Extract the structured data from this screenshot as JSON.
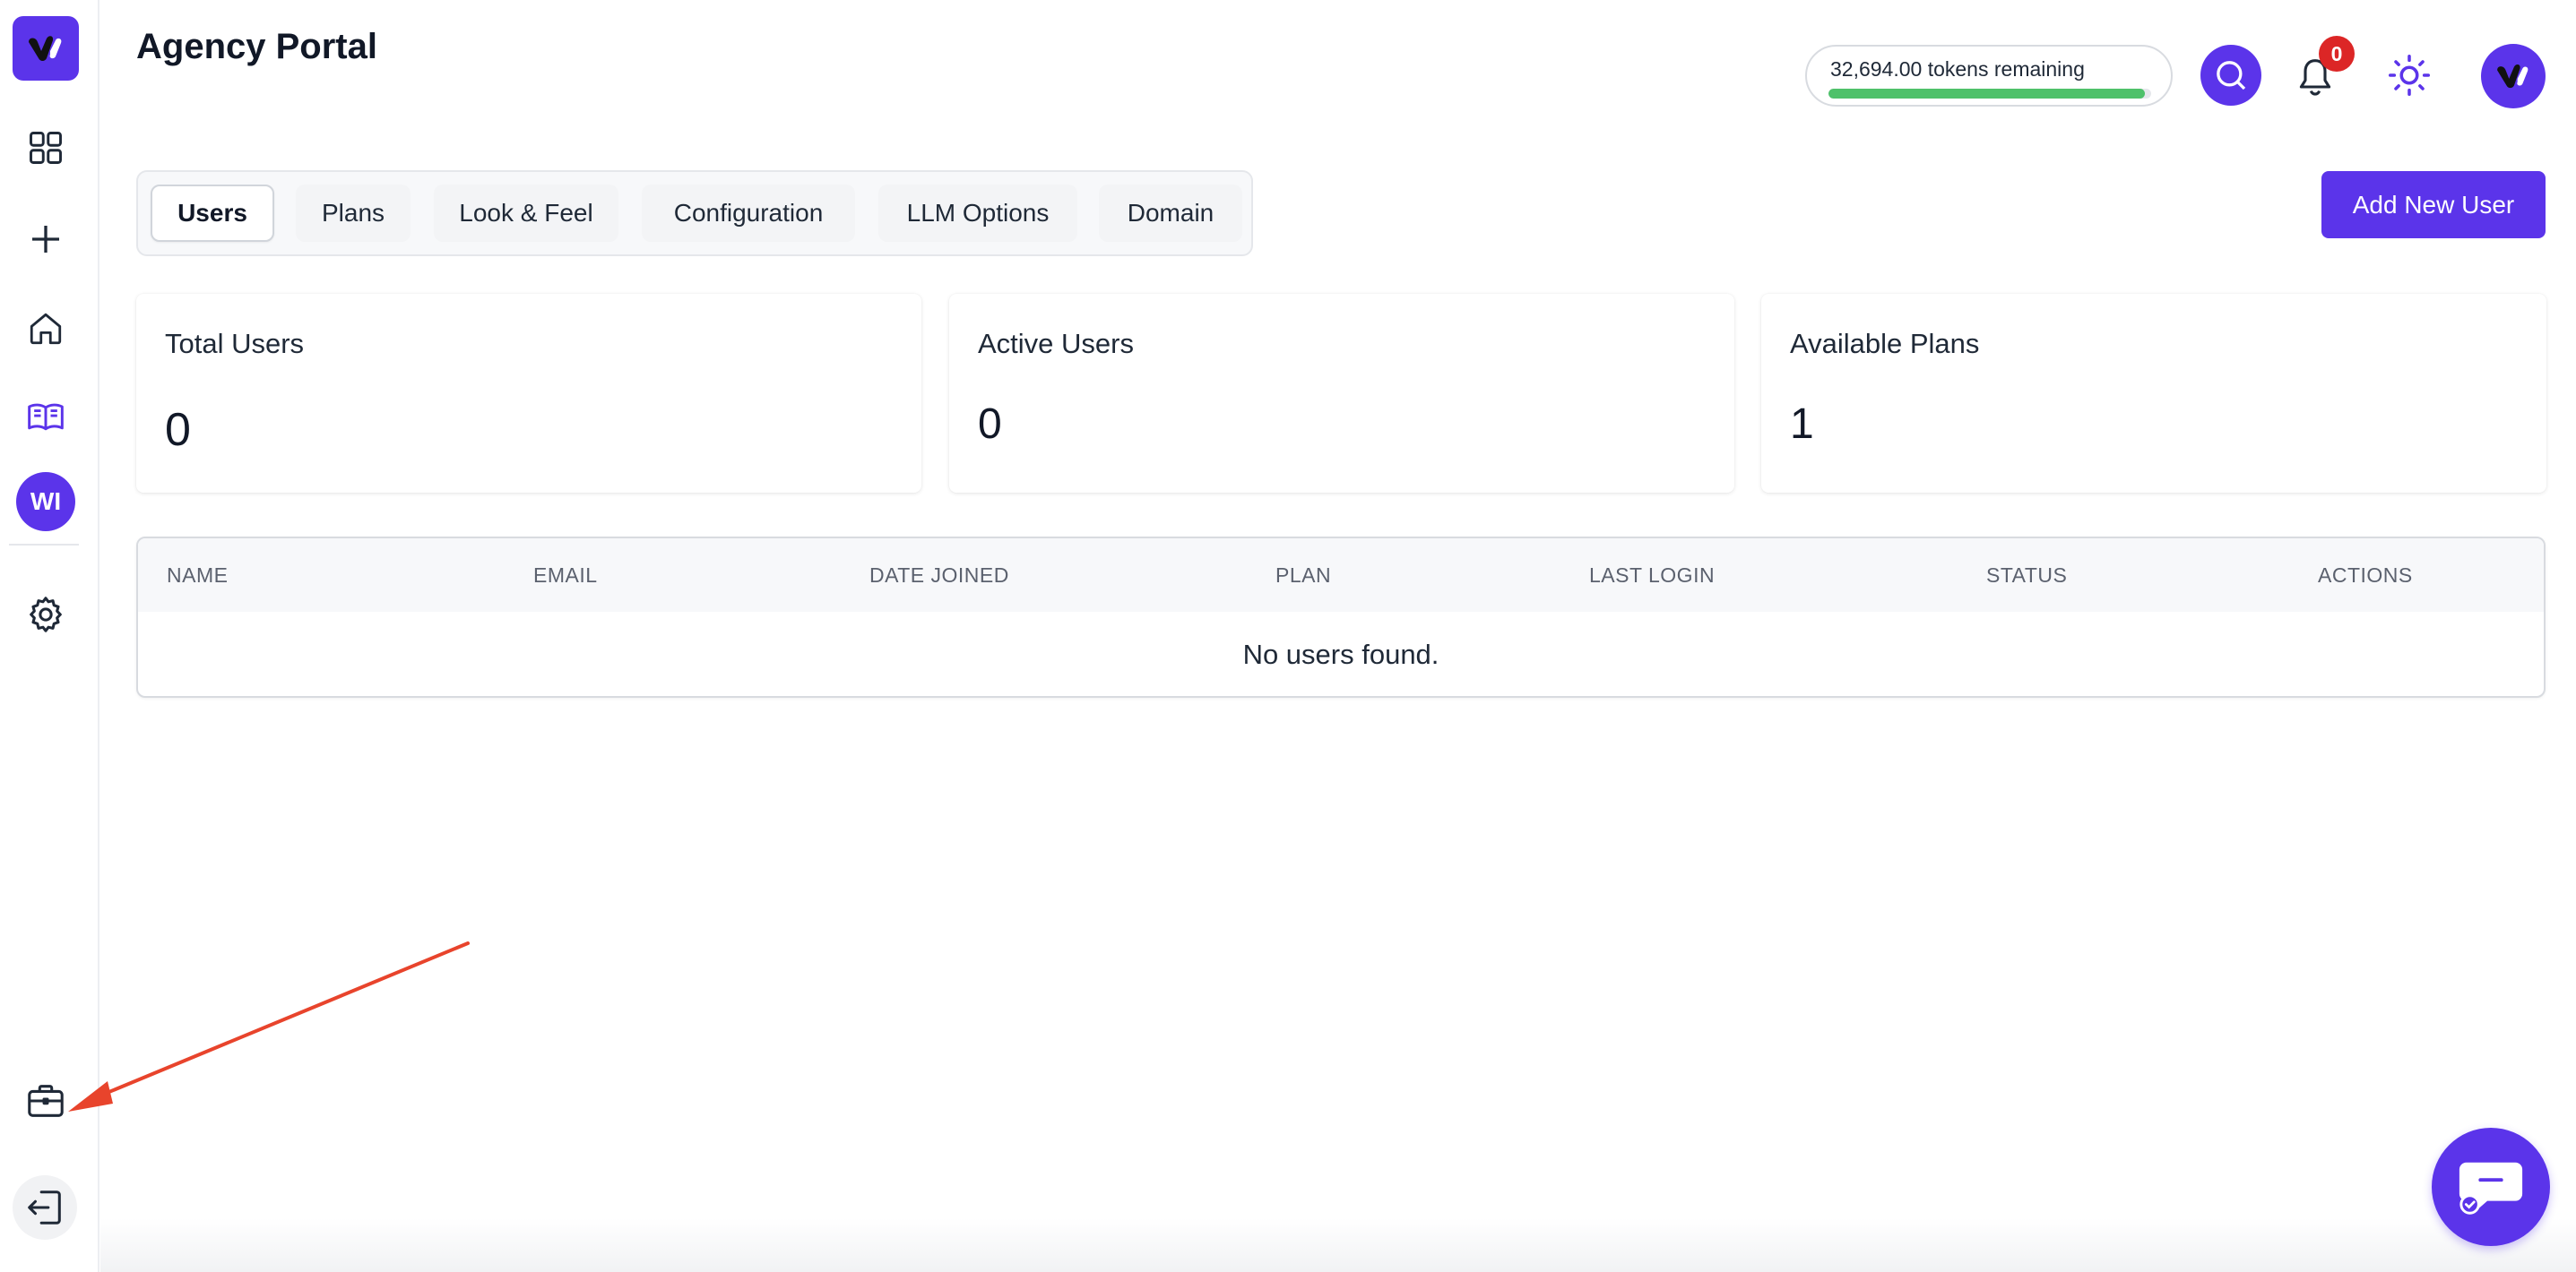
{
  "header": {
    "title": "Agency Portal",
    "tokens_text": "32,694.00 tokens remaining",
    "tokens_fraction": 0.98,
    "notification_count": "0"
  },
  "sidebar": {
    "avatar_initials": "WI",
    "items": [
      {
        "name": "dashboard-grid",
        "icon": "grid-icon"
      },
      {
        "name": "new",
        "icon": "plus-icon"
      },
      {
        "name": "home",
        "icon": "home-icon"
      },
      {
        "name": "library",
        "icon": "book-icon"
      },
      {
        "name": "settings",
        "icon": "gear-icon"
      },
      {
        "name": "agency",
        "icon": "briefcase-icon"
      },
      {
        "name": "logout",
        "icon": "logout-icon"
      }
    ]
  },
  "tabs": [
    {
      "label": "Users",
      "active": true
    },
    {
      "label": "Plans",
      "active": false
    },
    {
      "label": "Look & Feel",
      "active": false
    },
    {
      "label": "Configuration",
      "active": false
    },
    {
      "label": "LLM Options",
      "active": false
    },
    {
      "label": "Domain",
      "active": false
    }
  ],
  "actions": {
    "add_user_label": "Add New User"
  },
  "stats": [
    {
      "label": "Total Users",
      "value": "0"
    },
    {
      "label": "Active Users",
      "value": "0"
    },
    {
      "label": "Available Plans",
      "value": "1"
    }
  ],
  "table": {
    "columns": [
      "NAME",
      "EMAIL",
      "DATE JOINED",
      "PLAN",
      "LAST LOGIN",
      "STATUS",
      "ACTIONS"
    ],
    "empty_message": "No users found."
  },
  "colors": {
    "brand": "#5b34ea",
    "progress": "#4ec16a",
    "badge": "#dc2626",
    "annotation_arrow": "#e8442c"
  }
}
